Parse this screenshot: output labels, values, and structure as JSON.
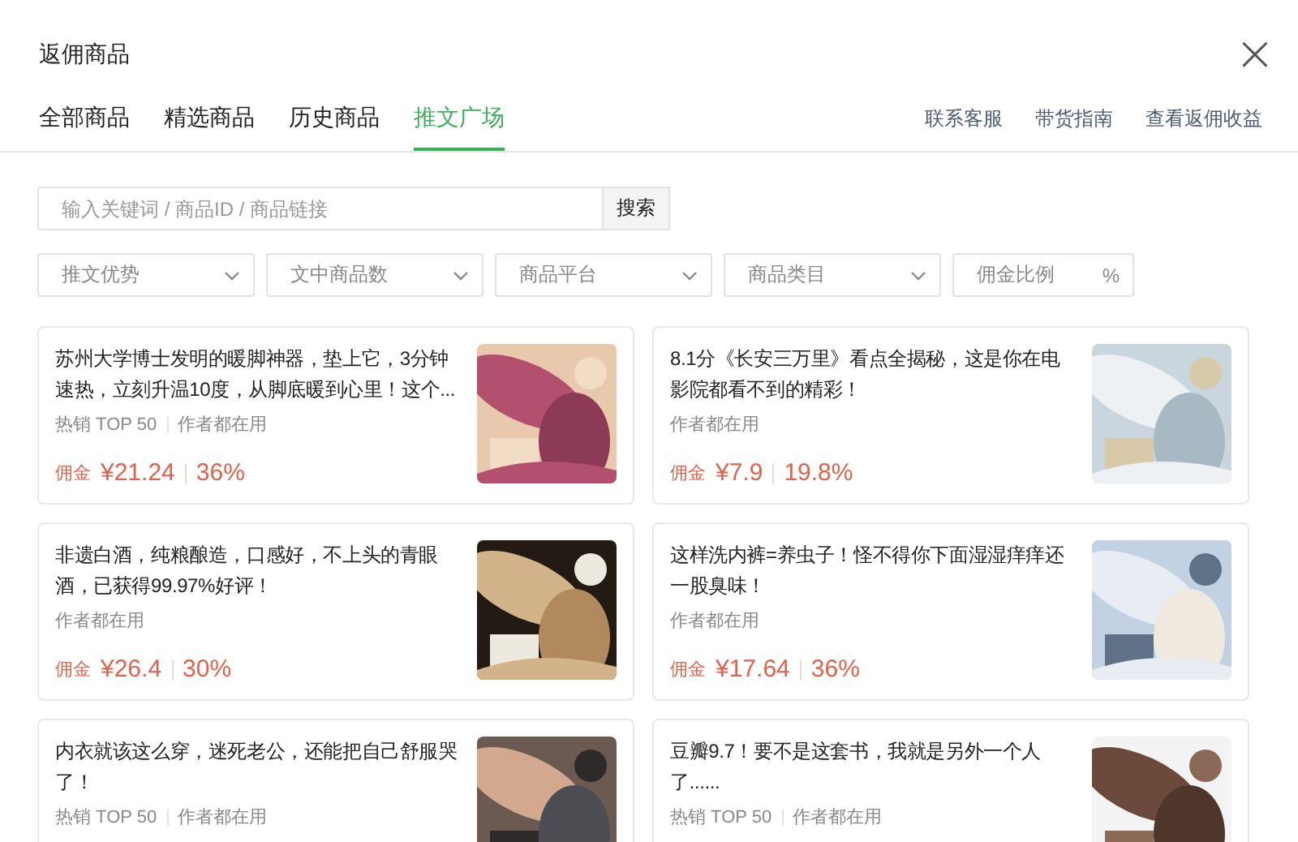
{
  "window": {
    "title": "返佣商品",
    "close": "×"
  },
  "tabs": [
    {
      "label": "全部商品",
      "selected": false
    },
    {
      "label": "精选商品",
      "selected": false
    },
    {
      "label": "历史商品",
      "selected": false
    },
    {
      "label": "推文广场",
      "selected": true
    }
  ],
  "links": [
    "联系客服",
    "带货指南",
    "查看返佣收益"
  ],
  "search": {
    "placeholder": "输入关键词 / 商品ID / 商品链接",
    "button": "搜索"
  },
  "filters": [
    {
      "kind": "dropdown",
      "placeholder": "推文优势"
    },
    {
      "kind": "dropdown",
      "placeholder": "文中商品数"
    },
    {
      "kind": "dropdown",
      "placeholder": "商品平台"
    },
    {
      "kind": "dropdown",
      "placeholder": "商品类目"
    },
    {
      "kind": "percent",
      "placeholder": "佣金比例",
      "unit": "%"
    }
  ],
  "cards": [
    {
      "title": "苏州大学博士发明的暖脚神器，垫上它，3分钟速热，立刻升温10度，从脚底暖到心里！这个...",
      "tags": [
        "热销 TOP 50",
        "作者都在用"
      ],
      "commission_label": "佣金",
      "price": "¥21.24",
      "rate": "36%",
      "image": {
        "kind": "picture"
      }
    },
    {
      "title": "8.1分《长安三万里》看点全揭秘，这是你在电影院都看不到的精彩！",
      "tags": [
        "作者都在用"
      ],
      "commission_label": "佣金",
      "price": "¥7.9",
      "rate": "19.8%",
      "image": {
        "kind": "picture"
      }
    },
    {
      "title": "非遗白酒，纯粮酿造，口感好，不上头的青眼酒，已获得99.97%好评！",
      "tags": [
        "作者都在用"
      ],
      "commission_label": "佣金",
      "price": "¥26.4",
      "rate": "30%",
      "image": {
        "kind": "picture"
      }
    },
    {
      "title": "这样洗内裤=养虫子！怪不得你下面湿湿痒痒还一股臭味！",
      "tags": [
        "作者都在用"
      ],
      "commission_label": "佣金",
      "price": "¥17.64",
      "rate": "36%",
      "image": {
        "kind": "picture"
      }
    },
    {
      "title": "内衣就该这么穿，迷死老公，还能把自己舒服哭了！",
      "tags": [
        "热销 TOP 50",
        "作者都在用"
      ],
      "image": {
        "kind": "picture"
      }
    },
    {
      "title": "豆瓣9.7！要不是这套书，我就是另外一个人了......",
      "tags": [
        "热销 TOP 50",
        "作者都在用"
      ],
      "image": {
        "kind": "picture"
      }
    }
  ]
}
